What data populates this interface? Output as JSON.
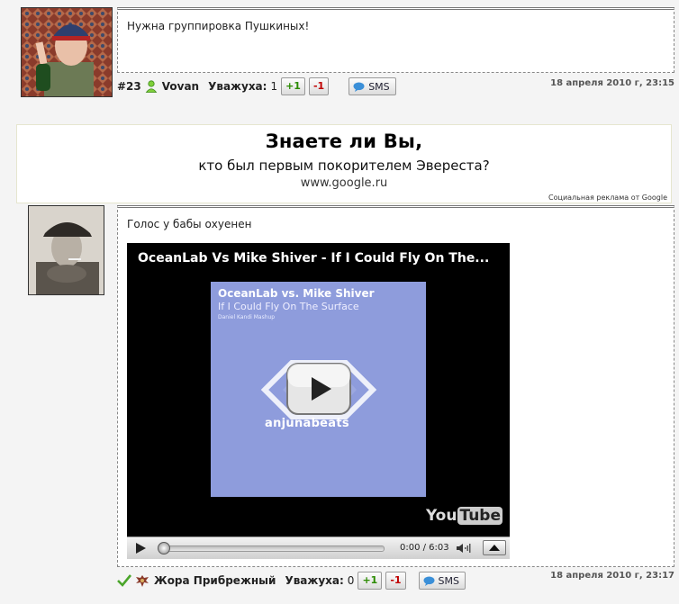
{
  "comment1": {
    "text": "Нужна группировка Пушкиных!",
    "post_number": "#23",
    "username": "Vovan",
    "rep_label": "Уважуха:",
    "rep_value": "1",
    "vote_plus": "+1",
    "vote_minus": "-1",
    "sms_label": "SMS",
    "date": "18 апреля 2010 г, 23:15"
  },
  "ad": {
    "title": "Знаете ли Вы,",
    "text": "кто был первым покорителем Эвереста?",
    "url": "www.google.ru",
    "credit": "Социальная реклама от Google"
  },
  "comment2": {
    "text": "Голос у бабы охуенен",
    "username": "Жора Прибрежный",
    "rep_label": "Уважуха:",
    "rep_value": "0",
    "vote_plus": "+1",
    "vote_minus": "-1",
    "sms_label": "SMS",
    "date": "18 апреля 2010 г, 23:17",
    "video": {
      "title": "OceanLab Vs Mike Shiver - If I Could Fly On The...",
      "cover_line1": "OceanLab vs. Mike Shiver",
      "cover_line2": "If I Could Fly On The Surface",
      "cover_line3": "Daniel Kandi Mashup",
      "cover_brand": "anjunabeats",
      "yt_you": "You",
      "yt_tube": "Tube",
      "time": "0:00 / 6:03",
      "progress": 0
    }
  },
  "colors": {
    "vote_plus": "#2a8a00",
    "vote_minus": "#c00000",
    "cover_bg": "#8e9cdc",
    "page_bg": "#f4f4f4"
  },
  "icons": [
    "user-online-icon",
    "sms-bubble-icon",
    "check-icon",
    "eagle-emblem-icon",
    "play-icon",
    "volume-icon",
    "fullscreen-icon",
    "play-overlay-icon"
  ]
}
